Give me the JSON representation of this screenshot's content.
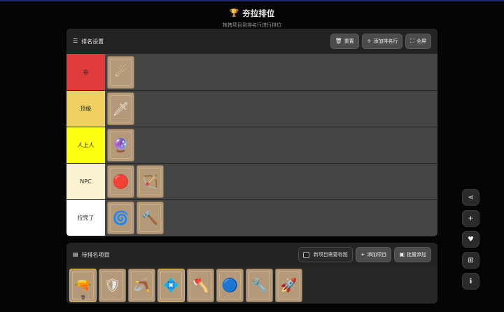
{
  "header": {
    "title": "夯拉排位",
    "subtitle": "拖拽项目到排名行进行排位"
  },
  "tiers_panel": {
    "title": "排名设置",
    "buttons": {
      "reset": "重置",
      "add_row": "添加排名行",
      "fullscreen": "全屏"
    },
    "rows": [
      {
        "label": "夯",
        "color": "#e03a3a",
        "items": [
          {
            "icon": "fire-bolt",
            "glyph": "☄"
          }
        ]
      },
      {
        "label": "顶级",
        "color": "#f0d060",
        "items": [
          {
            "icon": "dagger",
            "glyph": "🗡"
          }
        ]
      },
      {
        "label": "人上人",
        "color": "#ffff10",
        "items": [
          {
            "icon": "purple-flame",
            "glyph": "🔮"
          }
        ]
      },
      {
        "label": "NPC",
        "color": "#fbf3d0",
        "items": [
          {
            "icon": "orange-orb",
            "glyph": "🔴"
          },
          {
            "icon": "bow",
            "glyph": "🏹"
          }
        ]
      },
      {
        "label": "拉完了",
        "color": "#ffffff",
        "items": [
          {
            "icon": "golden-ring",
            "glyph": "🌀"
          },
          {
            "icon": "hammer",
            "glyph": "🔨"
          }
        ]
      }
    ]
  },
  "pool_panel": {
    "title": "待排名项目",
    "checkbox_label": "新项目需要标题",
    "buttons": {
      "add_item": "添加项目",
      "batch_add": "批量添加"
    },
    "items": [
      {
        "icon": "space-gun",
        "glyph": "🔫"
      },
      {
        "icon": "shield",
        "glyph": "🛡"
      },
      {
        "icon": "boomerang",
        "glyph": "🪃"
      },
      {
        "icon": "blue-gem",
        "glyph": "💠"
      },
      {
        "icon": "battle-axe",
        "glyph": "🪓"
      },
      {
        "icon": "water-ring",
        "glyph": "🔵"
      },
      {
        "icon": "rifle",
        "glyph": "🔧"
      },
      {
        "icon": "rocket",
        "glyph": "🚀"
      }
    ]
  },
  "side_buttons": [
    "share-icon",
    "plus-icon",
    "heart-icon",
    "grid-icon",
    "info-icon"
  ]
}
